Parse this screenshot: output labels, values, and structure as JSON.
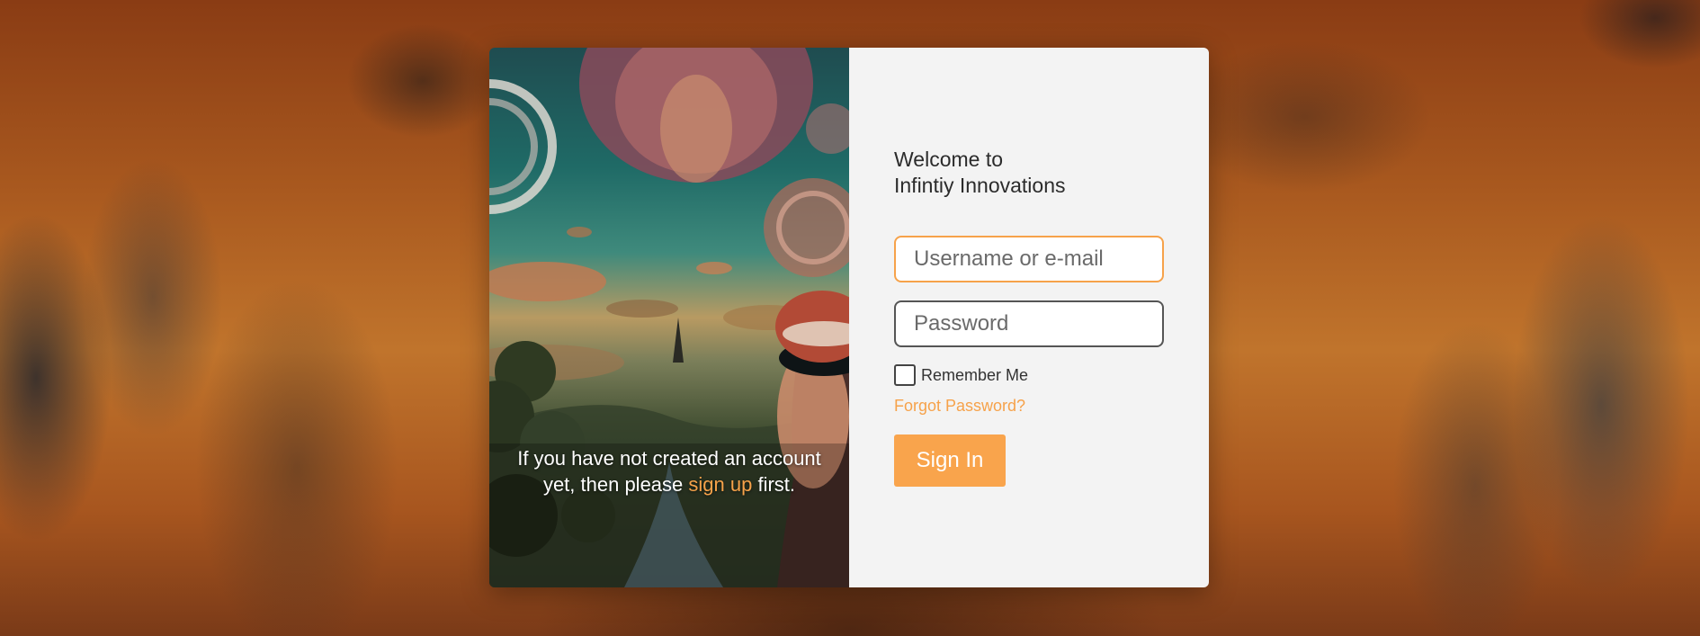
{
  "login": {
    "welcome_line1": "Welcome to",
    "welcome_line2": "Infintiy Innovations",
    "username_placeholder": "Username or e-mail",
    "password_placeholder": "Password",
    "remember_label": "Remember Me",
    "forgot_label": "Forgot Password?",
    "signin_label": "Sign In"
  },
  "art": {
    "caption_before": "If you have not created an account yet, then please",
    "caption_link": "sign up",
    "caption_after": "first."
  },
  "colors": {
    "accent": "#f9a44c",
    "panel_bg": "#f3f3f3"
  }
}
